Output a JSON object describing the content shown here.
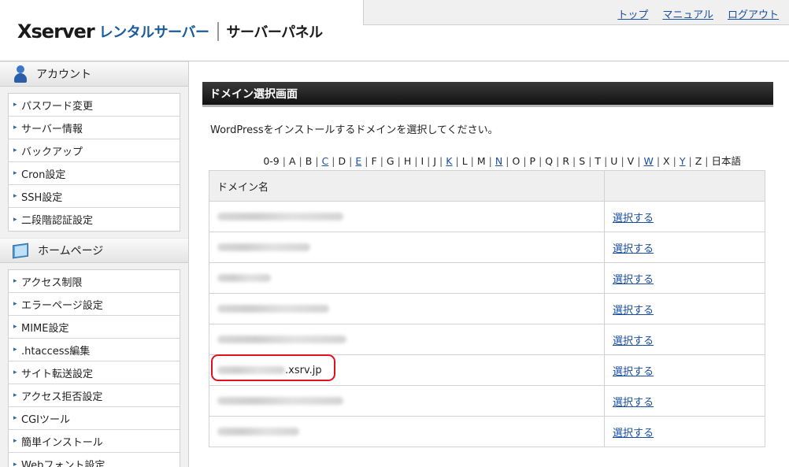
{
  "header": {
    "logo_x": "Xserver",
    "logo_rental": "レンタルサーバー",
    "logo_panel": "サーバーパネル",
    "nav": [
      "トップ",
      "マニュアル",
      "ログアウト"
    ]
  },
  "sidebar": {
    "sections": [
      {
        "title": "アカウント",
        "icon": "person-icon",
        "items": [
          "パスワード変更",
          "サーバー情報",
          "バックアップ",
          "Cron設定",
          "SSH設定",
          "二段階認証設定"
        ]
      },
      {
        "title": "ホームページ",
        "icon": "book-icon",
        "items": [
          "アクセス制限",
          "エラーページ設定",
          "MIME設定",
          ".htaccess編集",
          "サイト転送設定",
          "アクセス拒否設定",
          "CGIツール",
          "簡単インストール",
          "Webフォント設定"
        ]
      }
    ]
  },
  "main": {
    "title": "ドメイン選択画面",
    "description": "WordPressをインストールするドメインを選択してください。",
    "alpha_index": [
      "0-9",
      "A",
      "B",
      "C",
      "D",
      "E",
      "F",
      "G",
      "H",
      "I",
      "J",
      "K",
      "L",
      "M",
      "N",
      "O",
      "P",
      "Q",
      "R",
      "S",
      "T",
      "U",
      "V",
      "W",
      "X",
      "Y",
      "Z",
      "日本語"
    ],
    "alpha_links": [
      "C",
      "E",
      "K",
      "N",
      "W",
      "Y"
    ],
    "table": {
      "header_domain": "ドメイン名",
      "header_action": "",
      "rows": [
        {
          "domain": "",
          "action": "選択する"
        },
        {
          "domain": "",
          "action": "選択する"
        },
        {
          "domain": "",
          "action": "選択する"
        },
        {
          "domain": "",
          "action": "選択する"
        },
        {
          "domain": "",
          "action": "選択する"
        },
        {
          "domain": ".xsrv.jp",
          "action": "選択する"
        },
        {
          "domain": "",
          "action": "選択する"
        },
        {
          "domain": "",
          "action": "選択する"
        }
      ]
    },
    "highlight_color": "#e0101e"
  }
}
